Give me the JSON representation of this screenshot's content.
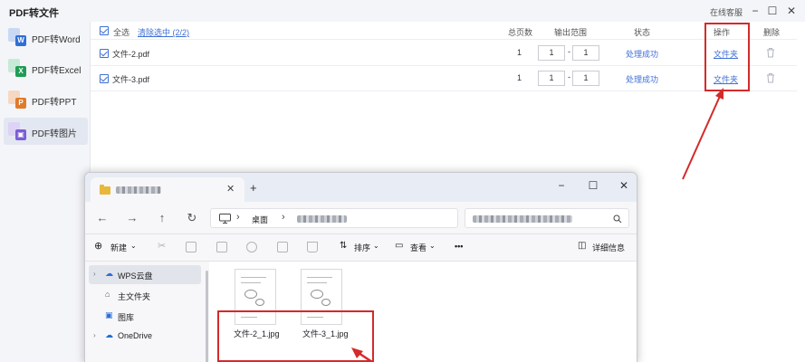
{
  "app": {
    "title": "PDF转文件",
    "customer_service": "在线客服",
    "window_controls": {
      "minimize": "−",
      "maximize": "☐",
      "close": "✕"
    }
  },
  "sidebar": {
    "items": [
      {
        "label": "PDF转Word",
        "icon": "word-icon",
        "color": "#2f6fd6",
        "badge": "W",
        "active": false
      },
      {
        "label": "PDF转Excel",
        "icon": "excel-icon",
        "color": "#1f9d55",
        "badge": "X",
        "active": false
      },
      {
        "label": "PDF转PPT",
        "icon": "ppt-icon",
        "color": "#e07a2c",
        "badge": "P",
        "active": false
      },
      {
        "label": "PDF转图片",
        "icon": "image-icon",
        "color": "#7b5cd6",
        "badge": "▣",
        "active": true
      }
    ]
  },
  "table": {
    "select_all": "全选",
    "clear_selected": "清除选中 (2/2)",
    "columns": {
      "pages": "总页数",
      "range": "输出范围",
      "status": "状态",
      "action": "操作",
      "delete": "删除"
    },
    "rows": [
      {
        "name": "文件-2.pdf",
        "pages": "1",
        "from": "1",
        "to": "1",
        "status": "处理成功",
        "action": "文件夹"
      },
      {
        "name": "文件-3.pdf",
        "pages": "1",
        "from": "1",
        "to": "1",
        "status": "处理成功",
        "action": "文件夹"
      }
    ]
  },
  "explorer": {
    "tab_close": "✕",
    "new_tab": "+",
    "window_controls": {
      "minimize": "−",
      "maximize": "☐",
      "close": "✕"
    },
    "breadcrumb": {
      "root": "桌面"
    },
    "toolbar": {
      "new": "新建",
      "sort": "排序",
      "view": "查看",
      "more": "•••",
      "details": "详细信息"
    },
    "nav": [
      {
        "label": "WPS云盘",
        "icon": "cloud-icon",
        "selected": true
      },
      {
        "label": "主文件夹",
        "icon": "home-icon",
        "selected": false
      },
      {
        "label": "图库",
        "icon": "gallery-icon",
        "selected": false
      },
      {
        "label": "OneDrive",
        "icon": "onedrive-icon",
        "selected": false
      }
    ],
    "files": [
      {
        "name": "文件-2_1.jpg"
      },
      {
        "name": "文件-3_1.jpg"
      }
    ]
  },
  "colors": {
    "accent": "#3f6fd6",
    "highlight": "#d42a2a"
  }
}
